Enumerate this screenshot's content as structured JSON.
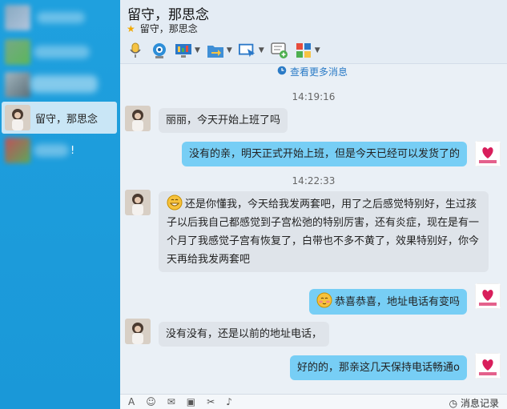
{
  "sidebar": {
    "contacts": [
      {
        "name": ""
      },
      {
        "name": ""
      },
      {
        "name": ""
      },
      {
        "name": "留守，那思念"
      },
      {
        "name": "!"
      }
    ]
  },
  "header": {
    "title": "留守，那思念",
    "subtitle": "留守，那思念",
    "toolbar": [
      "microphone-icon",
      "video-camera-icon",
      "screen-share-icon",
      "file-transfer-icon",
      "remote-assist-icon",
      "add-message-icon",
      "apps-icon"
    ]
  },
  "chat": {
    "more_messages": "查看更多消息",
    "timestamps": [
      "14:19:16",
      "14:22:33"
    ],
    "messages": [
      {
        "dir": "in",
        "text": "丽丽，今天开始上班了吗"
      },
      {
        "dir": "out",
        "text": "没有的亲，明天正式开始上班，但是今天已经可以发货了的"
      },
      {
        "dir": "in",
        "text_lines": [
          "还是你懂我，今天给我发两套吧，用了之后感觉特别好，生过孩",
          "子以后我自己都感觉到子宫松弛的特别厉害，还有炎症，现在是有一",
          "个月了我感觉子宫有恢复了，白带也不多不黄了，效果特别好，你今",
          "天再给我发两套吧"
        ]
      },
      {
        "dir": "out",
        "text": "恭喜恭喜，地址电话有变吗"
      },
      {
        "dir": "in",
        "text": "没有没有，还是以前的地址电话，"
      },
      {
        "dir": "out",
        "text": "好的的，那亲这几天保持电话畅通o"
      }
    ]
  },
  "inputbar": {
    "history_label": "消息记录"
  },
  "colors": {
    "sidebar": "#1a98d8",
    "bubble_out": "#77cef5",
    "bubble_in": "#dfe4ea",
    "link": "#2b7bc6"
  }
}
